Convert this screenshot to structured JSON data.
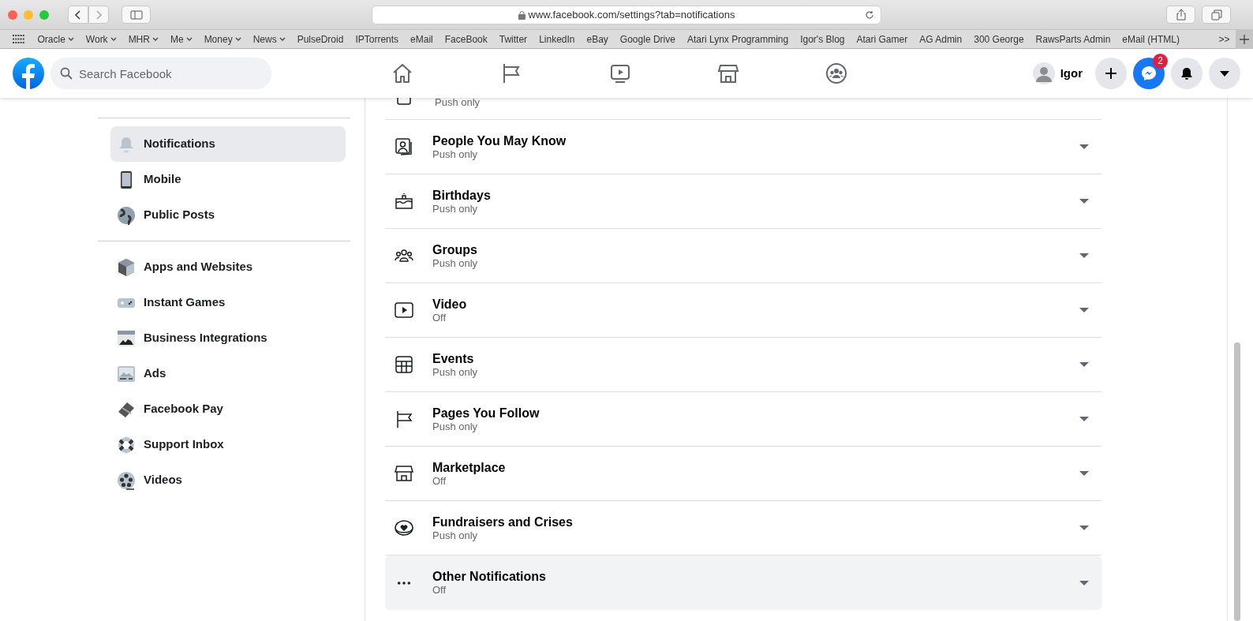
{
  "browser": {
    "url": "www.facebook.com/settings?tab=notifications",
    "bookmarks": [
      {
        "label": "Oracle",
        "dropdown": true
      },
      {
        "label": "Work",
        "dropdown": true
      },
      {
        "label": "MHR",
        "dropdown": true
      },
      {
        "label": "Me",
        "dropdown": true
      },
      {
        "label": "Money",
        "dropdown": true
      },
      {
        "label": "News",
        "dropdown": true
      },
      {
        "label": "PulseDroid",
        "dropdown": false
      },
      {
        "label": "IPTorrents",
        "dropdown": false
      },
      {
        "label": "eMail",
        "dropdown": false
      },
      {
        "label": "FaceBook",
        "dropdown": false
      },
      {
        "label": "Twitter",
        "dropdown": false
      },
      {
        "label": "LinkedIn",
        "dropdown": false
      },
      {
        "label": "eBay",
        "dropdown": false
      },
      {
        "label": "Google Drive",
        "dropdown": false
      },
      {
        "label": "Atari Lynx Programming",
        "dropdown": false
      },
      {
        "label": "Igor's Blog",
        "dropdown": false
      },
      {
        "label": "Atari Gamer",
        "dropdown": false
      },
      {
        "label": "AG Admin",
        "dropdown": false
      },
      {
        "label": "300 George",
        "dropdown": false
      },
      {
        "label": "RawsParts Admin",
        "dropdown": false
      },
      {
        "label": "eMail (HTML)",
        "dropdown": false
      }
    ],
    "overflow": ">>"
  },
  "header": {
    "search": {
      "placeholder": "Search Facebook"
    },
    "profile_name": "Igor",
    "messenger_badge": "2"
  },
  "sidebar": {
    "groups": [
      [
        {
          "label": "Notifications",
          "selected": true
        },
        {
          "label": "Mobile",
          "selected": false
        },
        {
          "label": "Public Posts",
          "selected": false
        }
      ],
      [
        {
          "label": "Apps and Websites",
          "selected": false
        },
        {
          "label": "Instant Games",
          "selected": false
        },
        {
          "label": "Business Integrations",
          "selected": false
        },
        {
          "label": "Ads",
          "selected": false
        },
        {
          "label": "Facebook Pay",
          "selected": false
        },
        {
          "label": "Support Inbox",
          "selected": false
        },
        {
          "label": "Videos",
          "selected": false
        }
      ]
    ]
  },
  "settings": {
    "clipped_row": {
      "subtitle": "Push only"
    },
    "rows": [
      {
        "title": "People You May Know",
        "subtitle": "Push only",
        "highlighted": false
      },
      {
        "title": "Birthdays",
        "subtitle": "Push only",
        "highlighted": false
      },
      {
        "title": "Groups",
        "subtitle": "Push only",
        "highlighted": false
      },
      {
        "title": "Video",
        "subtitle": "Off",
        "highlighted": false
      },
      {
        "title": "Events",
        "subtitle": "Push only",
        "highlighted": false
      },
      {
        "title": "Pages You Follow",
        "subtitle": "Push only",
        "highlighted": false
      },
      {
        "title": "Marketplace",
        "subtitle": "Off",
        "highlighted": false
      },
      {
        "title": "Fundraisers and Crises",
        "subtitle": "Push only",
        "highlighted": false
      },
      {
        "title": "Other Notifications",
        "subtitle": "Off",
        "highlighted": true
      }
    ]
  }
}
